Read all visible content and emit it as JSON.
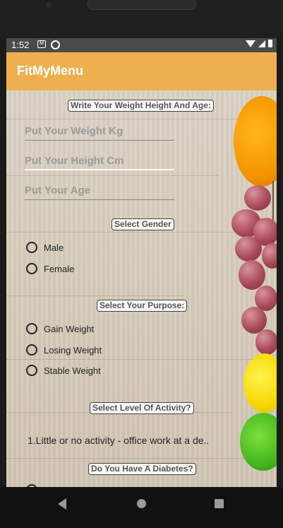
{
  "status_bar": {
    "time": "1:52",
    "icons": [
      "gmail-icon",
      "sync-icon",
      "wifi-icon",
      "signal-icon",
      "battery-icon"
    ]
  },
  "app_bar": {
    "title": "FitMyMenu"
  },
  "section_measurements": {
    "label": "Write Your Weight Height And Age:",
    "weight_placeholder": "Put Your Weight Kg",
    "height_placeholder": "Put Your Height Cm",
    "age_placeholder": "Put Your Age"
  },
  "section_gender": {
    "label": "Select Gender",
    "options": [
      "Male",
      "Female"
    ]
  },
  "section_purpose": {
    "label": "Select Your Purpose:",
    "options": [
      "Gain Weight",
      "Losing Weight",
      "Stable Weight"
    ]
  },
  "section_activity": {
    "label": "Select Level Of Activity?",
    "selected": "1.Little or no activity - office work at a de.."
  },
  "section_diabetes": {
    "label": "Do You Have A Diabetes?"
  },
  "colors": {
    "app_bar": "#eeb04f",
    "status_bar": "#4a4a4a",
    "nav_bar": "#111111"
  }
}
